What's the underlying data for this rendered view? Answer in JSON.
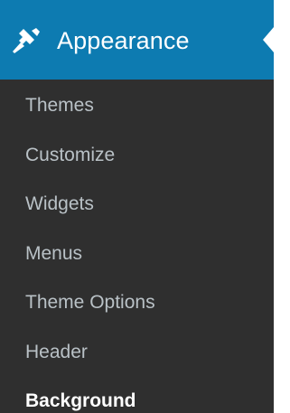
{
  "menu": {
    "header": {
      "label": "Appearance",
      "icon": "paintbrush-icon"
    },
    "items": [
      {
        "label": "Themes",
        "current": false
      },
      {
        "label": "Customize",
        "current": false
      },
      {
        "label": "Widgets",
        "current": false
      },
      {
        "label": "Menus",
        "current": false
      },
      {
        "label": "Theme Options",
        "current": false
      },
      {
        "label": "Header",
        "current": false
      },
      {
        "label": "Background",
        "current": true
      }
    ]
  },
  "colors": {
    "header_bg": "#0d7bb1",
    "menu_bg": "#2f2f2f",
    "item_text": "#b9c1c6",
    "current_text": "#ffffff"
  }
}
